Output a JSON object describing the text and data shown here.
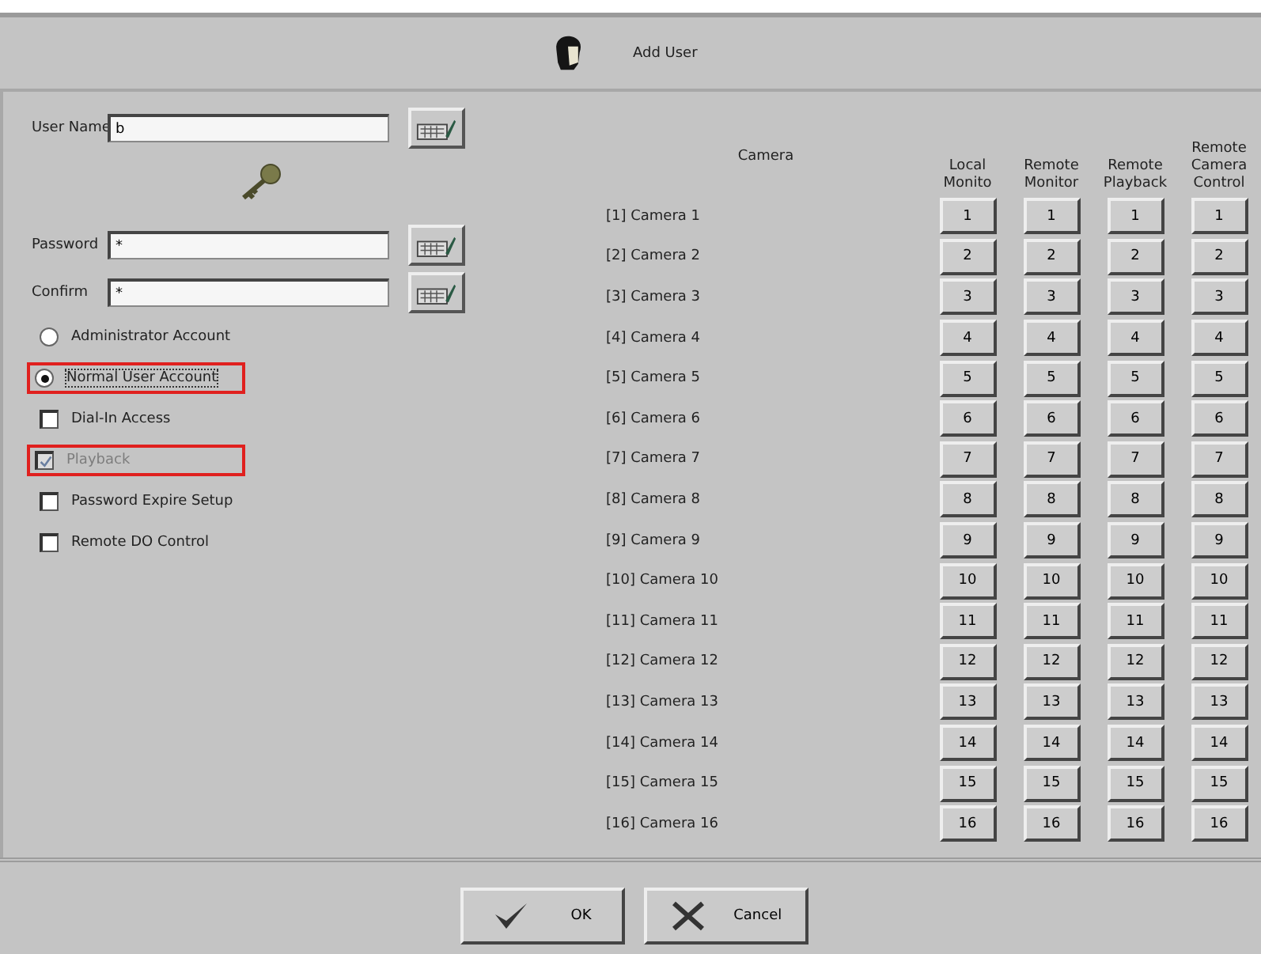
{
  "window": {
    "title": "Add User"
  },
  "fields": [
    {
      "label": "User Name",
      "value": "b"
    },
    {
      "label": "Password",
      "value": "*"
    },
    {
      "label": "Confirm",
      "value": "*"
    }
  ],
  "account_types": [
    {
      "label": "Administrator Account",
      "selected": false,
      "highlighted": false
    },
    {
      "label": "Normal User Account",
      "selected": true,
      "highlighted": true
    }
  ],
  "options": [
    {
      "label": "Dial-In Access",
      "checked": false,
      "disabled": false,
      "highlighted": false
    },
    {
      "label": "Playback",
      "checked": true,
      "disabled": true,
      "highlighted": true
    },
    {
      "label": "Password Expire Setup",
      "checked": false,
      "disabled": false,
      "highlighted": false
    },
    {
      "label": "Remote DO Control",
      "checked": false,
      "disabled": false,
      "highlighted": false
    }
  ],
  "camera_table": {
    "camera_header": "Camera",
    "permission_columns": [
      {
        "lines": [
          "Local",
          "Monito"
        ]
      },
      {
        "lines": [
          "Remote",
          "Monitor"
        ]
      },
      {
        "lines": [
          "Remote",
          "Playback"
        ]
      },
      {
        "lines": [
          "Remote",
          "Camera",
          "Control"
        ]
      }
    ],
    "rows": [
      {
        "camera": "[1] Camera 1",
        "buttons": [
          "1",
          "1",
          "1",
          "1"
        ]
      },
      {
        "camera": "[2] Camera 2",
        "buttons": [
          "2",
          "2",
          "2",
          "2"
        ]
      },
      {
        "camera": "[3] Camera 3",
        "buttons": [
          "3",
          "3",
          "3",
          "3"
        ]
      },
      {
        "camera": "[4] Camera 4",
        "buttons": [
          "4",
          "4",
          "4",
          "4"
        ]
      },
      {
        "camera": "[5] Camera 5",
        "buttons": [
          "5",
          "5",
          "5",
          "5"
        ]
      },
      {
        "camera": "[6] Camera 6",
        "buttons": [
          "6",
          "6",
          "6",
          "6"
        ]
      },
      {
        "camera": "[7] Camera 7",
        "buttons": [
          "7",
          "7",
          "7",
          "7"
        ]
      },
      {
        "camera": "[8] Camera 8",
        "buttons": [
          "8",
          "8",
          "8",
          "8"
        ]
      },
      {
        "camera": "[9] Camera 9",
        "buttons": [
          "9",
          "9",
          "9",
          "9"
        ]
      },
      {
        "camera": "[10] Camera 10",
        "buttons": [
          "10",
          "10",
          "10",
          "10"
        ]
      },
      {
        "camera": "[11] Camera 11",
        "buttons": [
          "11",
          "11",
          "11",
          "11"
        ]
      },
      {
        "camera": "[12] Camera 12",
        "buttons": [
          "12",
          "12",
          "12",
          "12"
        ]
      },
      {
        "camera": "[13] Camera 13",
        "buttons": [
          "13",
          "13",
          "13",
          "13"
        ]
      },
      {
        "camera": "[14] Camera 14",
        "buttons": [
          "14",
          "14",
          "14",
          "14"
        ]
      },
      {
        "camera": "[15] Camera 15",
        "buttons": [
          "15",
          "15",
          "15",
          "15"
        ]
      },
      {
        "camera": "[16] Camera 16",
        "buttons": [
          "16",
          "16",
          "16",
          "16"
        ]
      }
    ]
  },
  "buttons": [
    {
      "kind": "ok",
      "label": "OK"
    },
    {
      "kind": "cancel",
      "label": "Cancel"
    }
  ]
}
